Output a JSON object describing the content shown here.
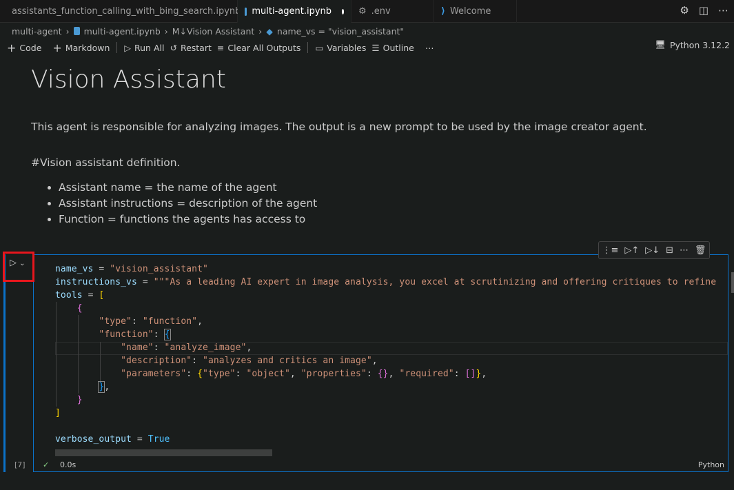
{
  "tabs": [
    {
      "label": "assistants_function_calling_with_bing_search.ipynb",
      "icon": "notebook-icon",
      "modified": true
    },
    {
      "label": "multi-agent.ipynb",
      "icon": "notebook-icon",
      "modified": true,
      "active": true
    },
    {
      "label": ".env",
      "icon": "gear-icon"
    },
    {
      "label": "Welcome",
      "icon": "vscode-icon"
    }
  ],
  "breadcrumb": [
    "multi-agent",
    "multi-agent.ipynb",
    "M↓Vision Assistant",
    "name_vs = \"vision_assistant\""
  ],
  "toolbar": {
    "code": "Code",
    "markdown": "Markdown",
    "run_all": "Run All",
    "restart": "Restart",
    "clear": "Clear All Outputs",
    "variables": "Variables",
    "outline": "Outline",
    "more": "⋯",
    "kernel": "Python 3.12.2"
  },
  "markdown": {
    "title": "Vision Assistant",
    "intro": "This agent is responsible for analyzing images. The output is a new prompt to be used by the image creator agent.",
    "definition": "#Vision assistant definition.",
    "bullets": [
      "Assistant name = the name of the agent",
      "Assistant instructions = description of the agent",
      "Function = functions the agents has access to"
    ]
  },
  "cell": {
    "exec_count": "[7]",
    "status_time": "0.0s",
    "language": "Python",
    "code": {
      "l1a": "name_vs",
      "l1b": " = ",
      "l1c": "\"vision_assistant\"",
      "l2a": "instructions_vs",
      "l2b": " = ",
      "l2c": "\"\"\"As a leading AI expert in image analysis, you excel at scrutinizing and offering critiques to refine",
      "l3a": "tools",
      "l3b": " = ",
      "l3c": "[",
      "l4": "{",
      "l5a": "\"type\"",
      "l5b": ": ",
      "l5c": "\"function\"",
      "l5d": ",",
      "l6a": "\"function\"",
      "l6b": ": ",
      "l6c": "{",
      "l7a": "\"name\"",
      "l7b": ": ",
      "l7c": "\"analyze_image\"",
      "l7d": ",",
      "l8a": "\"description\"",
      "l8b": ": ",
      "l8c": "\"analyzes and critics an image\"",
      "l8d": ",",
      "l9a": "\"parameters\"",
      "l9b": ": ",
      "l9c": "{",
      "l9d": "\"type\"",
      "l9e": ": ",
      "l9f": "\"object\"",
      "l9g": ", ",
      "l9h": "\"properties\"",
      "l9i": ": ",
      "l9j": "{}",
      "l9k": ", ",
      "l9l": "\"required\"",
      "l9m": ": ",
      "l9n": "[]",
      "l9o": "}",
      "l9p": ",",
      "l10a": "}",
      "l10b": ",",
      "l11": "}",
      "l12": "]",
      "l14a": "verbose_output",
      "l14b": " = ",
      "l14c": "True"
    }
  }
}
